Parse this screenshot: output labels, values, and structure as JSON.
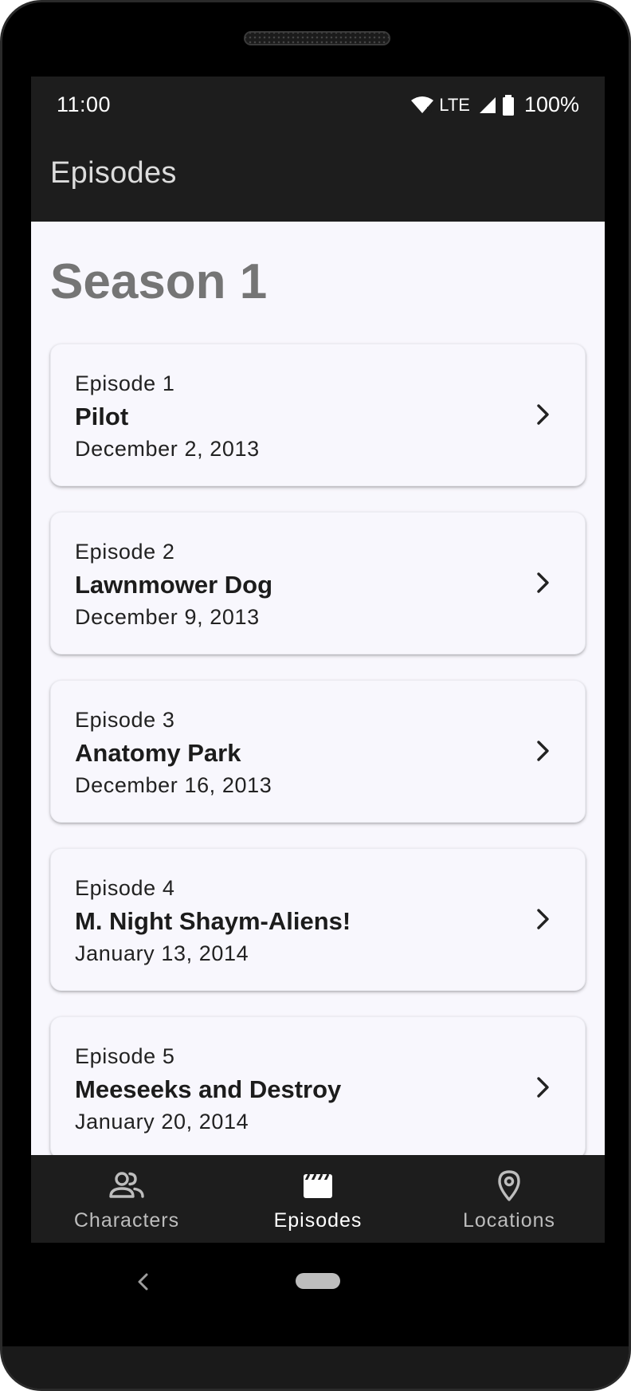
{
  "status_bar": {
    "time": "11:00",
    "network": "LTE",
    "battery": "100%"
  },
  "app_bar": {
    "title": "Episodes"
  },
  "season": {
    "title": "Season 1"
  },
  "episodes": [
    {
      "number": "Episode 1",
      "name": "Pilot",
      "date": "December 2, 2013"
    },
    {
      "number": "Episode 2",
      "name": "Lawnmower Dog",
      "date": "December 9, 2013"
    },
    {
      "number": "Episode 3",
      "name": "Anatomy Park",
      "date": "December 16, 2013"
    },
    {
      "number": "Episode 4",
      "name": "M. Night Shaym-Aliens!",
      "date": "January 13, 2014"
    },
    {
      "number": "Episode 5",
      "name": "Meeseeks and Destroy",
      "date": "January 20, 2014"
    }
  ],
  "bottom_nav": {
    "items": [
      {
        "label": "Characters",
        "icon": "people-icon"
      },
      {
        "label": "Episodes",
        "icon": "clapperboard-icon",
        "selected": true
      },
      {
        "label": "Locations",
        "icon": "location-pin-icon"
      }
    ]
  },
  "colors": {
    "bar_background": "#1d1d1d",
    "screen_background": "#f8f7fd",
    "season_title": "#757575"
  }
}
